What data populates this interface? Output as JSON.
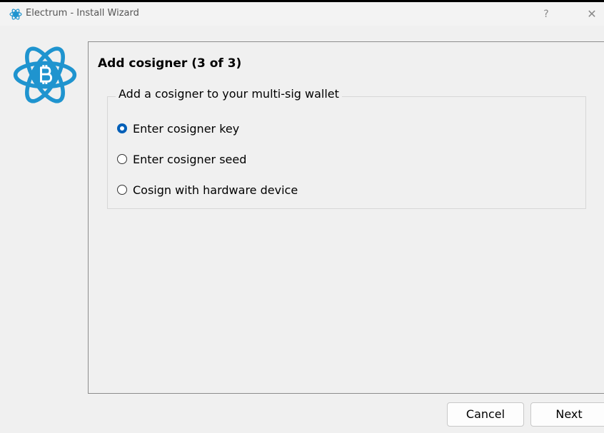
{
  "window": {
    "title": "Electrum  -  Install Wizard",
    "help_label": "?",
    "close_label": "✕",
    "app_icon": "electrum-logo-icon"
  },
  "page": {
    "heading": "Add cosigner (3 of 3)",
    "group_title": "Add a cosigner to your multi-sig wallet",
    "options": [
      {
        "label": "Enter cosigner key",
        "selected": true
      },
      {
        "label": "Enter cosigner seed",
        "selected": false
      },
      {
        "label": "Cosign with hardware device",
        "selected": false
      }
    ]
  },
  "buttons": {
    "cancel": "Cancel",
    "next": "Next"
  },
  "colors": {
    "accent": "#005fb8",
    "logo": "#1f94cf",
    "background": "#f0f0f0"
  }
}
